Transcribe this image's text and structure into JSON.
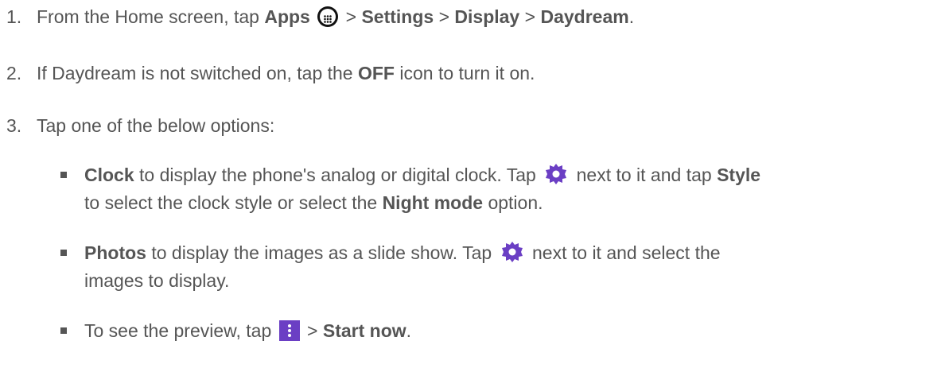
{
  "steps": [
    {
      "number": "1.",
      "parts": {
        "t1": "From the Home screen, tap ",
        "apps": "Apps",
        "t2": " > ",
        "settings": "Settings",
        "t3": " > ",
        "display": "Display",
        "t4": " > ",
        "daydream": "Daydream",
        "t5": "."
      }
    },
    {
      "number": "2.",
      "parts": {
        "t1": "If Daydream is not switched on, tap the ",
        "off": "OFF",
        "t2": " icon to turn it on."
      }
    },
    {
      "number": "3.",
      "parts": {
        "t1": "Tap one of the below options:"
      }
    }
  ],
  "bullets": [
    {
      "line1": {
        "clock": "Clock",
        "t1": " to display the phone's analog or digital clock. Tap ",
        "t2": " next to it and tap ",
        "style": "Style"
      },
      "line2": {
        "t1": "to select the clock style or select the ",
        "night": "Night mode",
        "t2": " option."
      }
    },
    {
      "line1": {
        "photos": "Photos",
        "t1": " to display the images as a slide show. Tap ",
        "t2": " next to it and select the"
      },
      "line2": {
        "t1": "images to display."
      }
    },
    {
      "line1": {
        "t1": "To see the preview, tap ",
        "t2": " > ",
        "start": "Start now",
        "t3": "."
      }
    }
  ],
  "icons": {
    "apps": "apps-grid-icon",
    "gear": "gear-icon",
    "menu": "more-vert-icon"
  },
  "colors": {
    "text": "#555555",
    "gear": "#6b3fc4",
    "menu_bg": "#6b3fc4",
    "apps_bg": "#111111"
  }
}
